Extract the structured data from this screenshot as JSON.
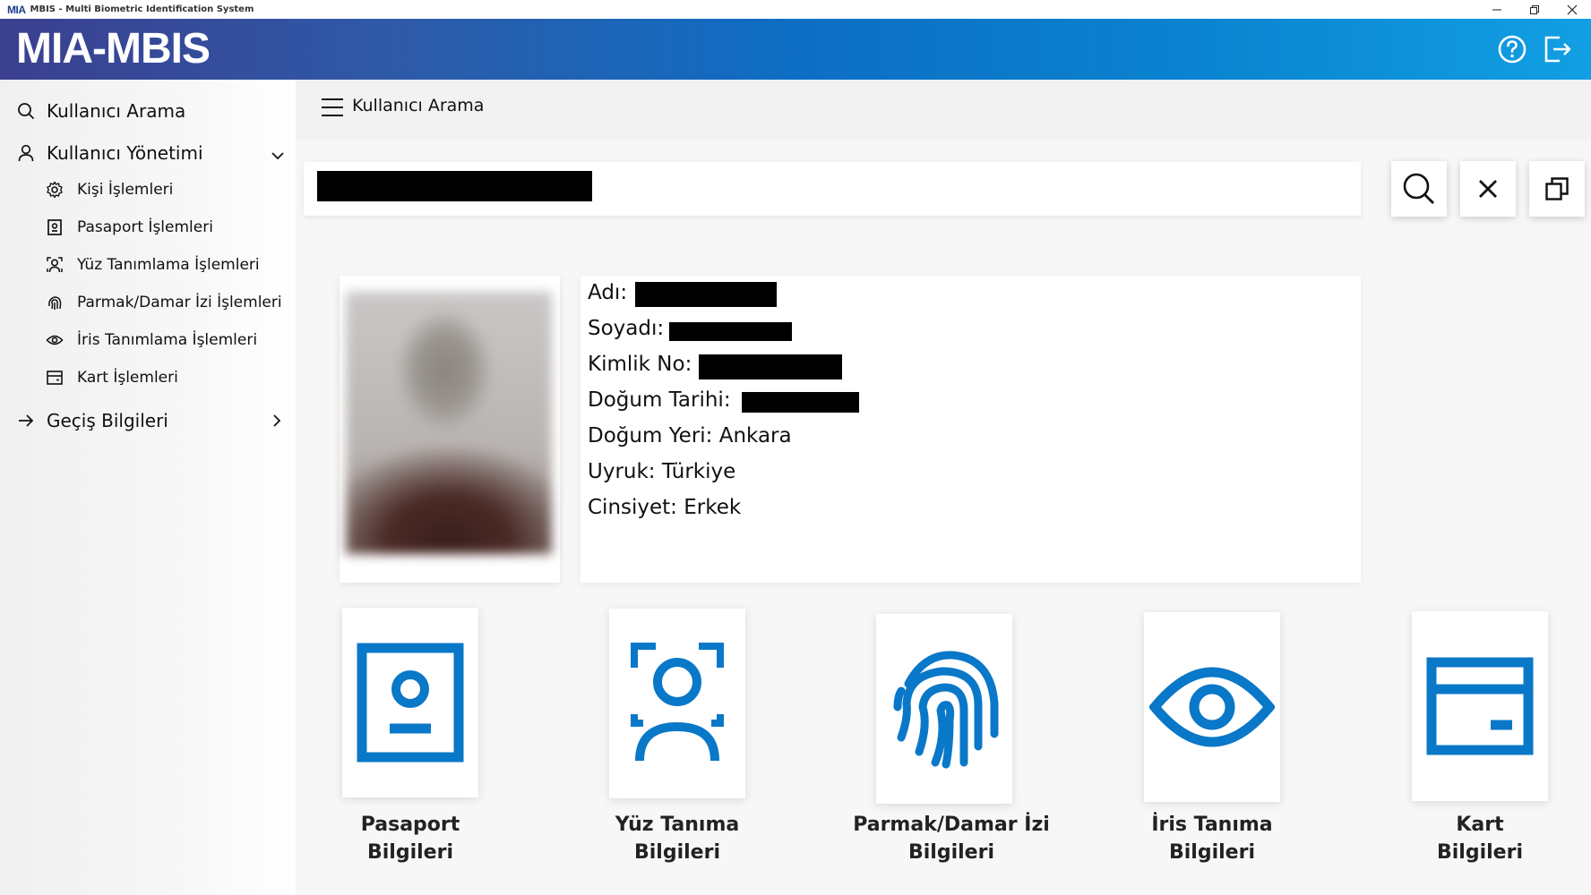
{
  "window": {
    "logo_text": "MIA",
    "title": "MBIS - Multi Biometric Identification System"
  },
  "header": {
    "brand": "MIA-MBIS",
    "help_icon": "help-circle-icon",
    "logout_icon": "logout-icon"
  },
  "sidebar": {
    "search_label": "Kullanıcı Arama",
    "user_mgmt_label": "Kullanıcı Yönetimi",
    "sub_items": [
      {
        "label": "Kişi İşlemleri",
        "icon": "gear-icon"
      },
      {
        "label": "Pasaport İşlemleri",
        "icon": "passport-icon"
      },
      {
        "label": "Yüz Tanımlama İşlemleri",
        "icon": "face-icon"
      },
      {
        "label": "Parmak/Damar İzi İşlemleri",
        "icon": "fingerprint-icon"
      },
      {
        "label": "İris Tanımlama İşlemleri",
        "icon": "eye-icon"
      },
      {
        "label": "Kart İşlemleri",
        "icon": "card-icon"
      }
    ],
    "transit_label": "Geçiş Bilgileri"
  },
  "page": {
    "title": "Kullanıcı Arama"
  },
  "person": {
    "name_label": "Adı:",
    "surname_label": "Soyadı:",
    "id_label": "Kimlik No:",
    "birthdate_label": "Doğum Tarihi:",
    "birthplace_label": "Doğum Yeri:",
    "birthplace_value": "Ankara",
    "nationality_label": "Uyruk:",
    "nationality_value": "Türkiye",
    "gender_label": "Cinsiyet:",
    "gender_value": "Erkek"
  },
  "bio_cards": [
    {
      "line1": "Pasaport",
      "line2": "Bilgileri",
      "icon": "passport-icon"
    },
    {
      "line1": "Yüz Tanıma",
      "line2": "Bilgileri",
      "icon": "face-icon"
    },
    {
      "line1": "Parmak/Damar İzi",
      "line2": "Bilgileri",
      "icon": "fingerprint-icon"
    },
    {
      "line1": "İris Tanıma",
      "line2": "Bilgileri",
      "icon": "eye-icon"
    },
    {
      "line1": "Kart",
      "line2": "Bilgileri",
      "icon": "card-icon"
    }
  ],
  "colors": {
    "accent": "#0a78c8",
    "header_start": "#3b3f8f",
    "header_end": "#129fe3"
  }
}
